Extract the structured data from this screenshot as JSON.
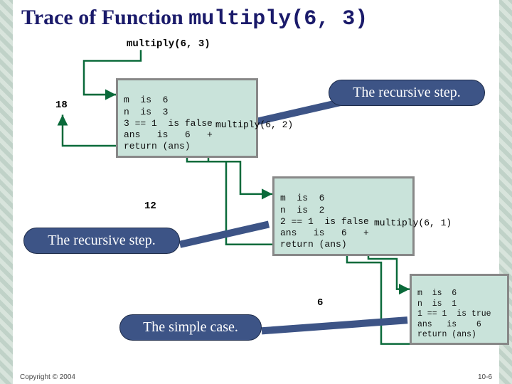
{
  "title_prefix": "Trace of Function ",
  "title_code": "multiply(6, 3)",
  "call_top": "multiply(6, 3)",
  "result1": "18",
  "result2": "12",
  "result3": "6",
  "box1_l1": "m  is  6",
  "box1_l2": "n  is  3",
  "box1_l3": "3 == 1  is false",
  "box1_l4": "ans   is   6   +",
  "box1_l5": "return (ans)",
  "box1_ext": "multiply(6, 2)",
  "box2_l1": "m  is  6",
  "box2_l2": "n  is  2",
  "box2_l3": "2 == 1  is false",
  "box2_l4": "ans   is   6   +",
  "box2_l5": "return (ans)",
  "box2_ext": "multiply(6, 1)",
  "box3_l1": "m  is  6",
  "box3_l2": "n  is  1",
  "box3_l3": "1 == 1  is true",
  "box3_l4": "ans   is    6",
  "box3_l5": "return (ans)",
  "callout_recursive": "The recursive step.",
  "callout_simple": "The simple case.",
  "copyright": "Copyright © 2004",
  "pagenum": "10-6"
}
